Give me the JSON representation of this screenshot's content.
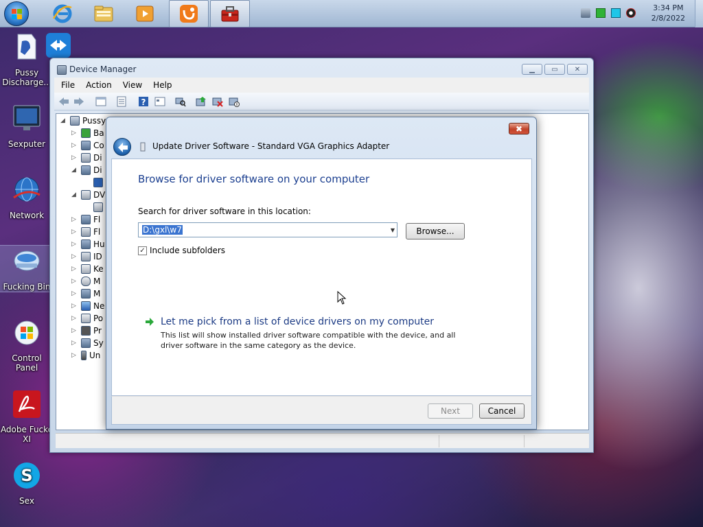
{
  "taskbar": {
    "clock": {
      "time": "3:34 PM",
      "date": "2/8/2022"
    },
    "pinned": [
      "internet-explorer-icon",
      "windows-explorer-icon",
      "media-player-icon",
      "uc-browser-icon",
      "device-manager-toolbox-icon"
    ]
  },
  "desktop": {
    "icons": [
      {
        "label": "Pussy Discharge..."
      },
      {
        "label": "Sexputer"
      },
      {
        "label": "Network"
      },
      {
        "label": "Fucking Bin"
      },
      {
        "label": "Control Panel"
      },
      {
        "label": "Adobe Fucke XI"
      },
      {
        "label": "Sex"
      }
    ]
  },
  "device_manager": {
    "title": "Device Manager",
    "menu": [
      "File",
      "Action",
      "View",
      "Help"
    ],
    "tree": [
      {
        "label": "Pussy",
        "expanded": true
      },
      {
        "label": "Ba"
      },
      {
        "label": "Co"
      },
      {
        "label": "Di"
      },
      {
        "label": "Di",
        "expanded": true
      },
      {
        "label": ""
      },
      {
        "label": "DV",
        "expanded": true
      },
      {
        "label": ""
      },
      {
        "label": "Fl"
      },
      {
        "label": "Fl"
      },
      {
        "label": "Hu"
      },
      {
        "label": "ID"
      },
      {
        "label": "Ke"
      },
      {
        "label": "M"
      },
      {
        "label": "M"
      },
      {
        "label": "Ne"
      },
      {
        "label": "Po"
      },
      {
        "label": "Pr"
      },
      {
        "label": "Sy"
      },
      {
        "label": "Un"
      }
    ]
  },
  "dialog": {
    "heading": "Update Driver Software - Standard VGA Graphics Adapter",
    "page_title": "Browse for driver software on your computer",
    "search_label": "Search for driver software in this location:",
    "path_value": "D:\\gxl\\w7",
    "browse_label": "Browse...",
    "include_subfolders_label": "Include subfolders",
    "include_subfolders_checked": true,
    "pick_title": "Let me pick from a list of device drivers on my computer",
    "pick_desc": "This list will show installed driver software compatible with the device, and all driver software in the same category as the device.",
    "next_label": "Next",
    "cancel_label": "Cancel",
    "close_glyph": "✖"
  },
  "colors": {
    "dialog_link": "#1b3a84",
    "page_title": "#1a3e8f",
    "selection": "#3a74d0",
    "close_button": "#c0432a"
  }
}
